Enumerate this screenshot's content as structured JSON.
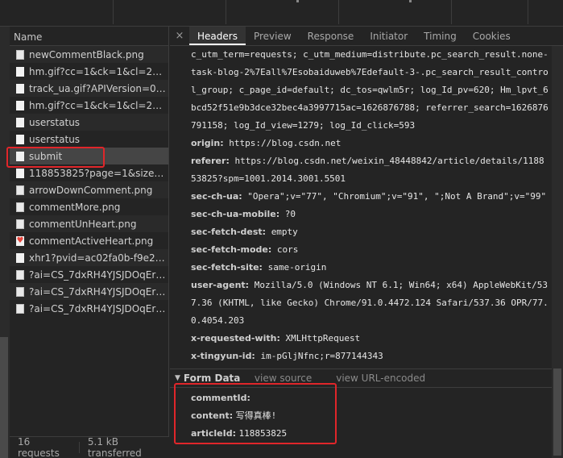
{
  "request_list": {
    "column_header": "Name",
    "items": [
      {
        "name": "newCommentBlack.png",
        "icon": "image-file-icon"
      },
      {
        "name": "hm.gif?cc=1&ck=1&cl=24-bit…",
        "icon": "file-icon"
      },
      {
        "name": "track_ua.gif?APIVersion=0.6.0…",
        "icon": "file-icon"
      },
      {
        "name": "hm.gif?cc=1&ck=1&cl=24-bit…",
        "icon": "file-icon"
      },
      {
        "name": "userstatus",
        "icon": "file-icon"
      },
      {
        "name": "userstatus",
        "icon": "file-icon"
      },
      {
        "name": "submit",
        "icon": "file-icon"
      },
      {
        "name": "118853825?page=1&size=10…",
        "icon": "file-icon"
      },
      {
        "name": "arrowDownComment.png",
        "icon": "image-file-icon"
      },
      {
        "name": "commentMore.png",
        "icon": "image-file-icon"
      },
      {
        "name": "commentUnHeart.png",
        "icon": "image-file-icon"
      },
      {
        "name": "commentActiveHeart.png",
        "icon": "heart-icon"
      },
      {
        "name": "xhr1?pvid=ac02fa0b-f9e2-43b…",
        "icon": "file-icon"
      },
      {
        "name": "?ai=CS_7dxRH4YJSJDOqErtoPi…",
        "icon": "image-file-icon"
      },
      {
        "name": "?ai=CS_7dxRH4YJSJDOqErtoPi…",
        "icon": "image-file-icon"
      },
      {
        "name": "?ai=CS_7dxRH4YJSJDOqErtoPi…",
        "icon": "image-file-icon"
      }
    ],
    "selected_index": 6
  },
  "status_bar": {
    "requests": "16 requests",
    "transferred": "5.1 kB transferred"
  },
  "tabs": [
    "Headers",
    "Preview",
    "Response",
    "Initiator",
    "Timing",
    "Cookies"
  ],
  "active_tab": "Headers",
  "headers": {
    "cookie_continuation": "c_utm_term=requests; c_utm_medium=distribute.pc_search_result.none-task-blog-2%7Eall%7Esobaiduweb%7Edefault-3-.pc_search_result_control_group; c_page_id=default; dc_tos=qwlm5r; log_Id_pv=620; Hm_lpvt_6bcd52f51e9b3dce32bec4a3997715ac=1626876788; referrer_search=1626876791158; log_Id_view=1279; log_Id_click=593",
    "items": [
      {
        "key": "origin:",
        "value": "https://blog.csdn.net"
      },
      {
        "key": "referer:",
        "value": "https://blog.csdn.net/weixin_48448842/article/details/118853825?spm=1001.2014.3001.5501"
      },
      {
        "key": "sec-ch-ua:",
        "value": "\"Opera\";v=\"77\", \"Chromium\";v=\"91\", \";Not A Brand\";v=\"99\""
      },
      {
        "key": "sec-ch-ua-mobile:",
        "value": "?0"
      },
      {
        "key": "sec-fetch-dest:",
        "value": "empty"
      },
      {
        "key": "sec-fetch-mode:",
        "value": "cors"
      },
      {
        "key": "sec-fetch-site:",
        "value": "same-origin"
      },
      {
        "key": "user-agent:",
        "value": "Mozilla/5.0 (Windows NT 6.1; Win64; x64) AppleWebKit/537.36 (KHTML, like Gecko) Chrome/91.0.4472.124 Safari/537.36 OPR/77.0.4054.203"
      },
      {
        "key": "x-requested-with:",
        "value": "XMLHttpRequest"
      },
      {
        "key": "x-tingyun-id:",
        "value": "im-pGljNfnc;r=877144343"
      }
    ]
  },
  "form_data": {
    "title": "Form Data",
    "view_source": "view source",
    "view_url_encoded": "view URL-encoded",
    "items": [
      {
        "key": "commentId:",
        "value": ""
      },
      {
        "key": "content:",
        "value": "写得真棒!"
      },
      {
        "key": "articleId:",
        "value": "118853825"
      }
    ]
  },
  "close_symbol": "×",
  "highlight_color": "#e0262a"
}
